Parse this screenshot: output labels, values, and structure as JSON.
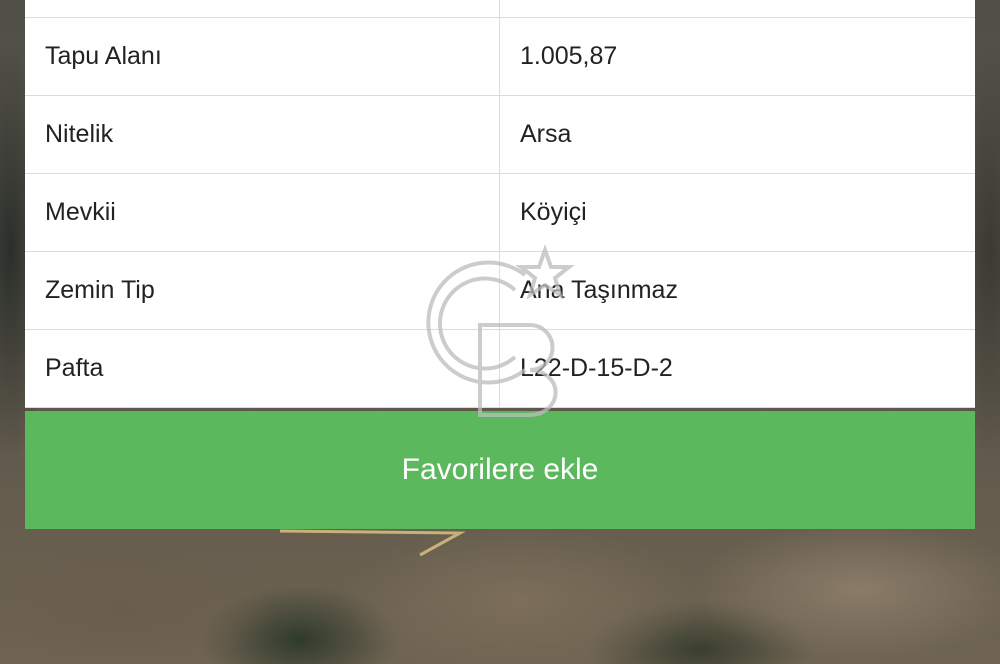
{
  "details": {
    "rows": [
      {
        "label": "Tapu Alanı",
        "value": "1.005,87"
      },
      {
        "label": "Nitelik",
        "value": "Arsa"
      },
      {
        "label": "Mevkii",
        "value": "Köyiçi"
      },
      {
        "label": "Zemin Tip",
        "value": "Ana Taşınmaz"
      },
      {
        "label": "Pafta",
        "value": "L22-D-15-D-2"
      }
    ]
  },
  "actions": {
    "favorite_label": "Favorilere ekle"
  },
  "colors": {
    "button": "#5cb85c",
    "divider": "#dcdcdc"
  }
}
